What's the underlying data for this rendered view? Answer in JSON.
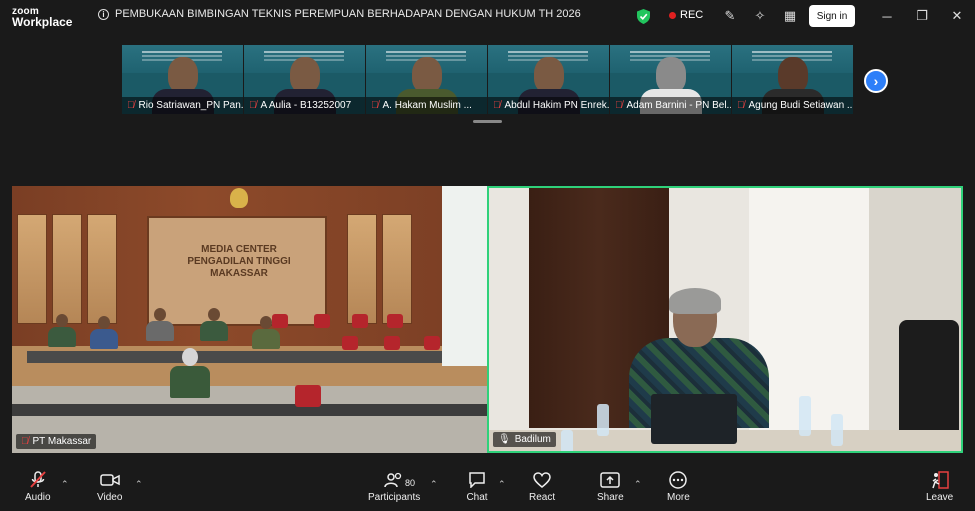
{
  "app": {
    "brand_line1": "zoom",
    "brand_line2": "Workplace"
  },
  "meeting": {
    "title": "PEMBUKAAN BIMBINGAN TEKNIS PEREMPUAN BERHADAPAN DENGAN HUKUM TH 2026"
  },
  "titlebar": {
    "rec_label": "REC",
    "signin_label": "Sign in"
  },
  "participants_strip": [
    {
      "name": "Rio Satriawan_PN Pan..."
    },
    {
      "name": "A Aulia - B13252007"
    },
    {
      "name": "A. Hakam Muslim ..."
    },
    {
      "name": "Abdul Hakim PN Enrek..."
    },
    {
      "name": "Adam Barnini - PN Bel..."
    },
    {
      "name": "Agung Budi Setiawan ..."
    }
  ],
  "main_videos": [
    {
      "name": "PT Makassar",
      "board_lines": [
        "MEDIA CENTER",
        "PENGADILAN TINGGI",
        "MAKASSAR"
      ]
    },
    {
      "name": "Badilum"
    }
  ],
  "toolbar": {
    "audio": "Audio",
    "video": "Video",
    "participants": "Participants",
    "participant_count": "80",
    "chat": "Chat",
    "react": "React",
    "share": "Share",
    "more": "More",
    "leave": "Leave"
  },
  "colors": {
    "active_speaker_border": "#2fd17a",
    "rec": "#e02020",
    "next_button": "#2d7ff9",
    "mute": "#e64040"
  }
}
